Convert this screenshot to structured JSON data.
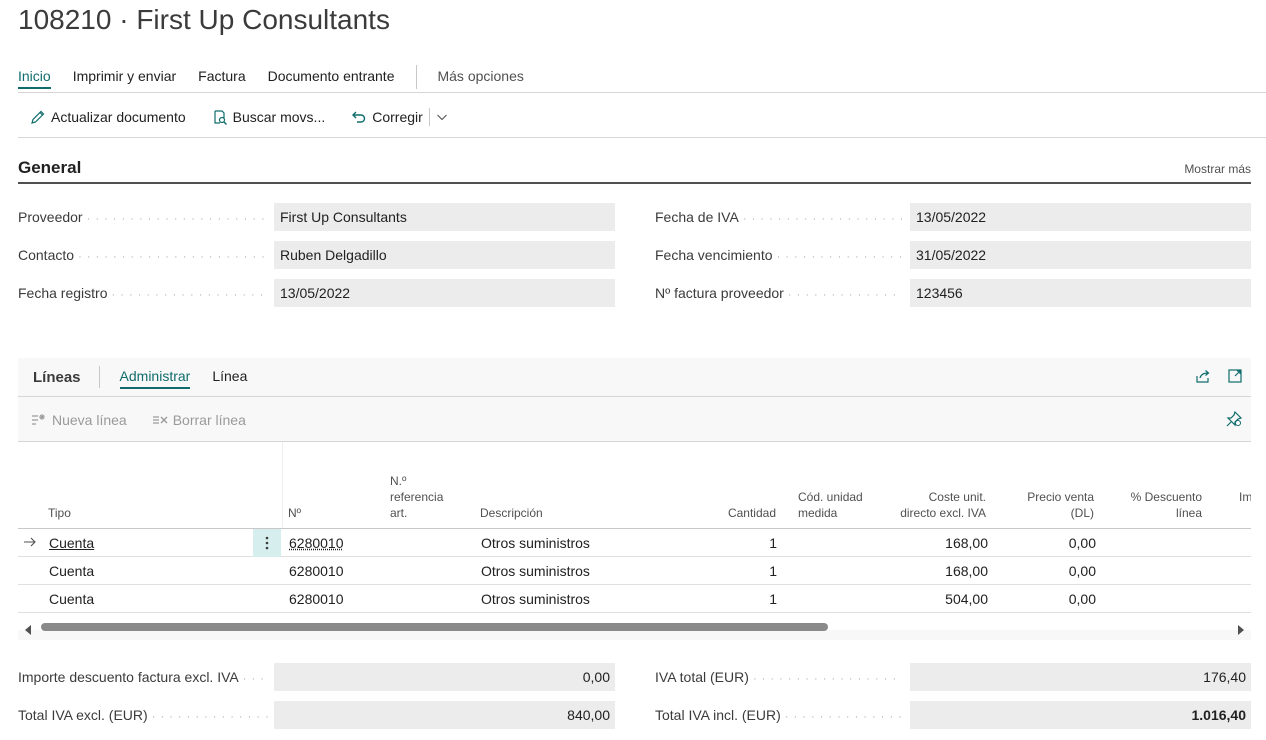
{
  "page": {
    "title": "108210 · First Up Consultants"
  },
  "tabs": [
    {
      "label": "Inicio"
    },
    {
      "label": "Imprimir y enviar"
    },
    {
      "label": "Factura"
    },
    {
      "label": "Documento entrante"
    },
    {
      "label": "Más opciones"
    }
  ],
  "actions": {
    "update": "Actualizar documento",
    "find": "Buscar movs...",
    "correct": "Corregir"
  },
  "general": {
    "title": "General",
    "show_more": "Mostrar más",
    "vendor_label": "Proveedor",
    "vendor_value": "First Up Consultants",
    "contact_label": "Contacto",
    "contact_value": "Ruben Delgadillo",
    "posting_date_label": "Fecha registro",
    "posting_date_value": "13/05/2022",
    "vat_date_label": "Fecha de IVA",
    "vat_date_value": "13/05/2022",
    "due_date_label": "Fecha vencimiento",
    "due_date_value": "31/05/2022",
    "vendor_invoice_label": "Nº factura proveedor",
    "vendor_invoice_value": "123456"
  },
  "lines": {
    "title": "Líneas",
    "tabs": [
      "Administrar",
      "Línea"
    ],
    "new_line": "Nueva línea",
    "delete_line": "Borrar línea",
    "columns": {
      "type": "Tipo",
      "no": "Nº",
      "ref_1": "N.º",
      "ref_2": "referencia",
      "ref_3": "art.",
      "description": "Descripción",
      "quantity": "Cantidad",
      "uom_1": "Cód. unidad",
      "uom_2": "medida",
      "cost_1": "Coste unit.",
      "cost_2": "directo excl. IVA",
      "price_1": "Precio venta",
      "price_2": "(DL)",
      "disc_1": "% Descuento",
      "disc_2": "línea",
      "amount_cut": "Im"
    },
    "rows": [
      {
        "type": "Cuenta",
        "no": "6280010",
        "description": "Otros suministros",
        "quantity": "1",
        "unit_cost": "168,00",
        "unit_price": "0,00"
      },
      {
        "type": "Cuenta",
        "no": "6280010",
        "description": "Otros suministros",
        "quantity": "1",
        "unit_cost": "168,00",
        "unit_price": "0,00"
      },
      {
        "type": "Cuenta",
        "no": "6280010",
        "description": "Otros suministros",
        "quantity": "1",
        "unit_cost": "504,00",
        "unit_price": "0,00"
      }
    ]
  },
  "totals": {
    "invoice_discount_label": "Importe descuento factura excl. IVA",
    "invoice_discount_value": "0,00",
    "total_excl_label": "Total IVA excl. (EUR)",
    "total_excl_value": "840,00",
    "total_vat_label": "IVA total (EUR)",
    "total_vat_value": "176,40",
    "total_incl_label": "Total IVA incl. (EUR)",
    "total_incl_value": "1.016,40"
  },
  "colors": {
    "accent": "#106c6c",
    "field_bg": "#ececec",
    "selected_cell": "#d7eeee"
  }
}
